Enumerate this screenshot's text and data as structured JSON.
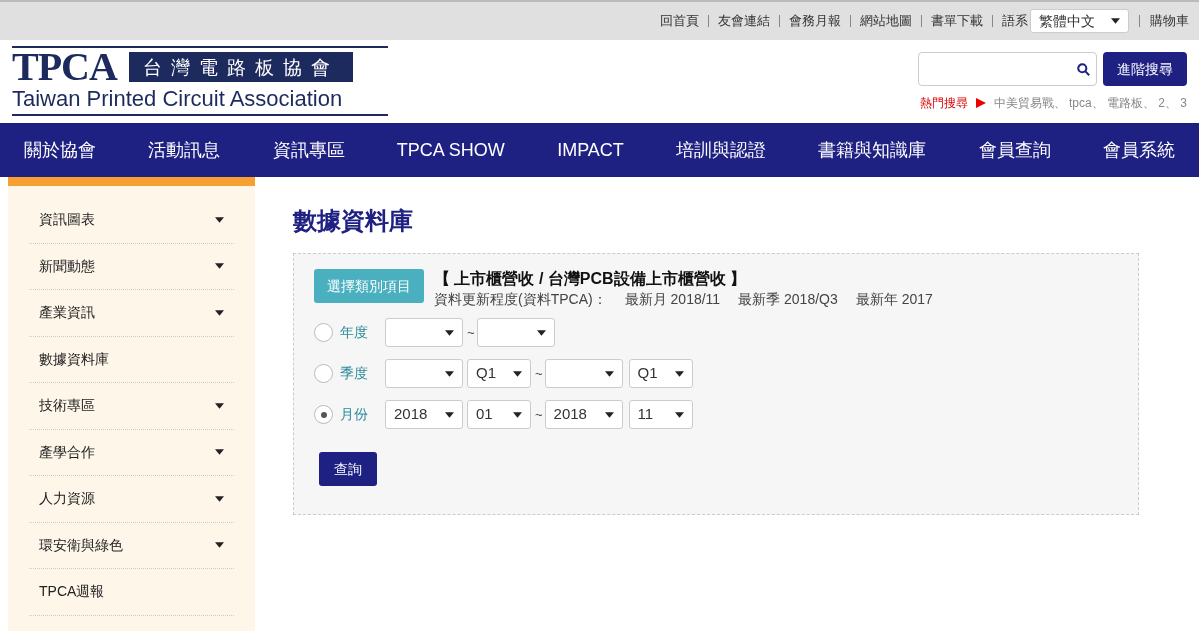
{
  "top_links": [
    "回首頁",
    "友會連結",
    "會務月報",
    "網站地圖",
    "書單下載"
  ],
  "language": {
    "label": "語系",
    "value": "繁體中文"
  },
  "cart_link": "購物車",
  "logo": {
    "mark": "TPCA",
    "chinese": "台灣電路板協會",
    "english": "Taiwan Printed Circuit Association"
  },
  "search": {
    "advanced_button": "進階搜尋"
  },
  "hot_search": {
    "label": "熱門搜尋",
    "terms": "中美貿易戰、 tpca、 電路板、 2、 3"
  },
  "nav": [
    "關於協會",
    "活動訊息",
    "資訊專區",
    "TPCA SHOW",
    "IMPACT",
    "培訓與認證",
    "書籍與知識庫",
    "會員查詢",
    "會員系統"
  ],
  "sidebar": [
    {
      "label": "資訊圖表",
      "expandable": true
    },
    {
      "label": "新聞動態",
      "expandable": true
    },
    {
      "label": "產業資訊",
      "expandable": true
    },
    {
      "label": "數據資料庫",
      "expandable": false
    },
    {
      "label": "技術專區",
      "expandable": true
    },
    {
      "label": "產學合作",
      "expandable": true
    },
    {
      "label": "人力資源",
      "expandable": true
    },
    {
      "label": "環安衛與綠色",
      "expandable": true
    },
    {
      "label": "TPCA週報",
      "expandable": false
    }
  ],
  "page_title": "數據資料庫",
  "query": {
    "category_button": "選擇類別項目",
    "category_title": "【 上市櫃營收 / 台灣PCB設備上市櫃營收 】",
    "update_label": "資料更新程度(資料TPCA)：",
    "updates": [
      "最新月 2018/11",
      "最新季 2018/Q3",
      "最新年 2017"
    ],
    "range_separator": "~",
    "rows": [
      {
        "label": "年度",
        "selected": false,
        "from": [
          {
            "kind": "blank"
          }
        ],
        "to": [
          {
            "kind": "blank"
          }
        ]
      },
      {
        "label": "季度",
        "selected": false,
        "from": [
          {
            "kind": "blank"
          },
          {
            "kind": "filled",
            "value": "Q1"
          }
        ],
        "to": [
          {
            "kind": "blank"
          },
          {
            "kind": "filled",
            "value": "Q1"
          }
        ]
      },
      {
        "label": "月份",
        "selected": true,
        "from": [
          {
            "kind": "filled",
            "value": "2018"
          },
          {
            "kind": "filled",
            "value": "01"
          }
        ],
        "to": [
          {
            "kind": "filled",
            "value": "2018"
          },
          {
            "kind": "filled",
            "value": "11"
          }
        ]
      }
    ],
    "submit_button": "查詢"
  }
}
